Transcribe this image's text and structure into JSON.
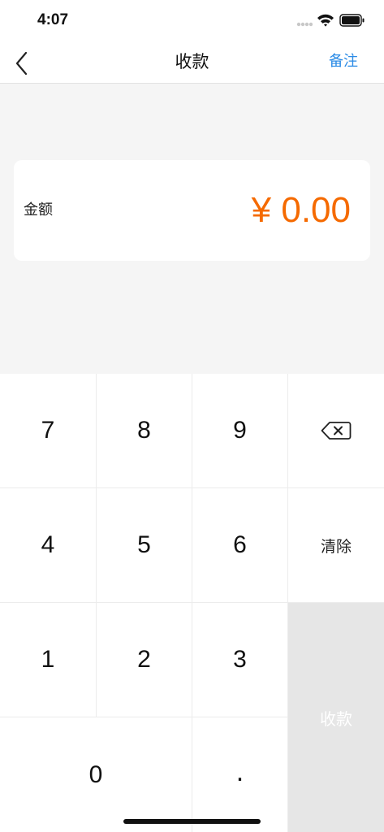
{
  "status_bar": {
    "time": "4:07"
  },
  "nav": {
    "back_icon": "chevron-left-icon",
    "title": "收款",
    "note_label": "备注"
  },
  "amount": {
    "label": "金额",
    "value": "¥ 0.00"
  },
  "keypad": {
    "keys": [
      "7",
      "8",
      "9",
      "4",
      "5",
      "6",
      "1",
      "2",
      "3",
      "0",
      "."
    ],
    "backspace_icon": "backspace-icon",
    "clear_label": "清除",
    "confirm_label": "收款"
  },
  "colors": {
    "accent": "#2b8be6",
    "amount": "#f56a00",
    "confirm_bg": "#e6e6e6"
  }
}
